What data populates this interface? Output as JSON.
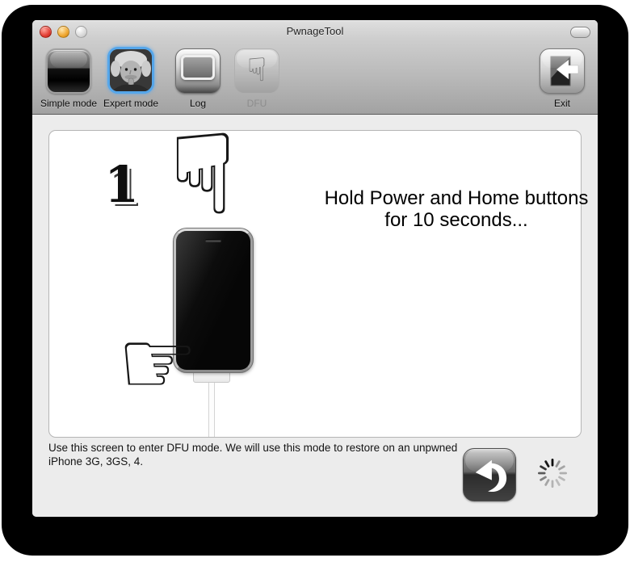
{
  "window": {
    "title": "PwnageTool",
    "controls": [
      "close",
      "minimize",
      "zoom-disabled"
    ]
  },
  "toolbar": {
    "items": [
      {
        "label": "Simple mode",
        "state": "enabled",
        "icon": "black-glass-app-icon"
      },
      {
        "label": "Expert mode",
        "state": "selected",
        "icon": "einstein-photo-icon"
      },
      {
        "label": "Log",
        "state": "enabled",
        "icon": "window-screen-icon"
      },
      {
        "label": "DFU",
        "state": "disabled",
        "icon": "hand-pointing-down-icon"
      }
    ],
    "exit_label": "Exit"
  },
  "main": {
    "step_number": "1",
    "headline": "Hold Power and Home buttons for 10 seconds...",
    "illustration": {
      "hand_down_glyph": "☟",
      "hand_right_glyph": "☞",
      "device": "iphone-with-dock-cable"
    }
  },
  "footer": {
    "instruction": "Use this screen to enter DFU mode. We will use this mode to restore on an unpwned iPhone 3G, 3GS, 4.",
    "back_icon": "curved-back-arrow",
    "spinner": "progress-spinner"
  },
  "colors": {
    "selection_blue": "#55a6ea",
    "content_bg": "#ececec",
    "chrome_top": "#dfdfdf",
    "chrome_bottom": "#a2a2a2",
    "panel_bg": "#ffffff"
  }
}
